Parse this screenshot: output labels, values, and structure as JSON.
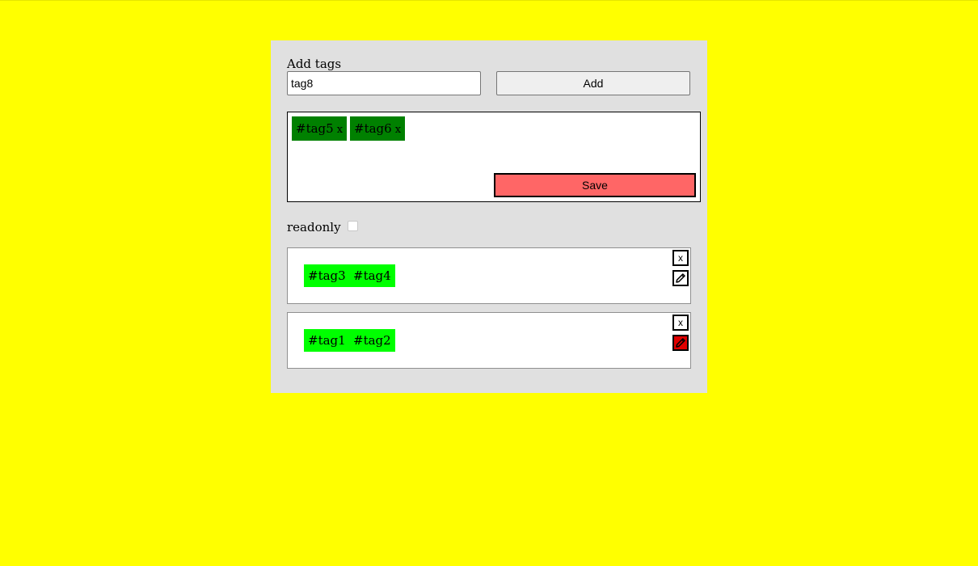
{
  "colors": {
    "page_background": "#ffff00",
    "panel_background": "#e0e0e0",
    "editor_tag": "#008000",
    "saved_tag": "#00ff00",
    "save_button": "#ff6666",
    "active_edit": "#e00000"
  },
  "add_form": {
    "label": "Add tags",
    "input_value": "tag8",
    "add_button": "Add"
  },
  "editor": {
    "tags": [
      {
        "text": "#tag5",
        "remove": "x"
      },
      {
        "text": "#tag6",
        "remove": "x"
      }
    ],
    "save_button": "Save"
  },
  "readonly": {
    "label": "readonly",
    "checked": false
  },
  "cards": [
    {
      "tags": [
        "#tag3",
        "#tag4"
      ],
      "close": "x",
      "edit_icon": "pencil-icon",
      "editing": false
    },
    {
      "tags": [
        "#tag1",
        "#tag2"
      ],
      "close": "x",
      "edit_icon": "pencil-icon",
      "editing": true
    }
  ]
}
